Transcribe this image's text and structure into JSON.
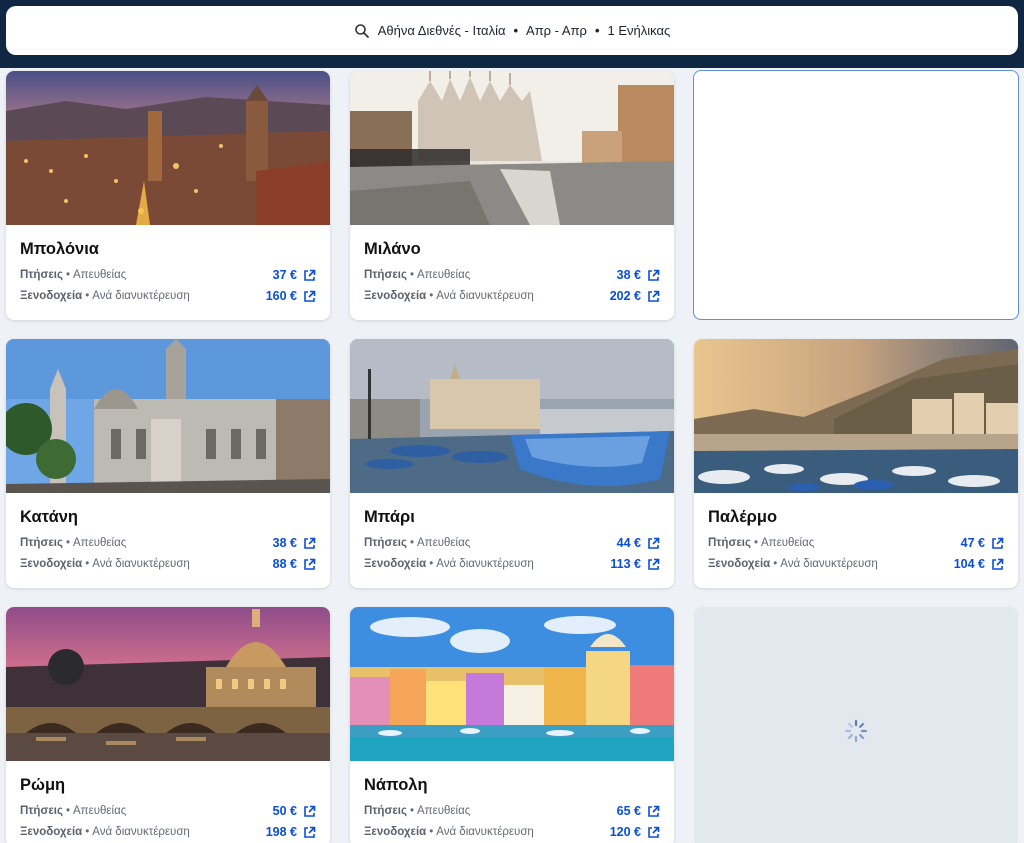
{
  "search": {
    "origin_destination": "Αθήνα Διεθνές - Ιταλία",
    "dates": "Απρ - Απρ",
    "travellers": "1 Ενήλικας",
    "separator": "•"
  },
  "labels": {
    "flights": "Πτήσεις",
    "hotels": "Ξενοδοχεία",
    "flights_detail": "Απευθείας",
    "hotels_detail": "Ανά διανυκτέρευση",
    "bullet": "•"
  },
  "destinations": [
    {
      "city": "Μπολόνια",
      "flight_price": "37 €",
      "hotel_price": "160 €"
    },
    {
      "city": "Μιλάνο",
      "flight_price": "38 €",
      "hotel_price": "202 €"
    },
    {
      "city": "Κατάνη",
      "flight_price": "38 €",
      "hotel_price": "88 €"
    },
    {
      "city": "Μπάρι",
      "flight_price": "44 €",
      "hotel_price": "113 €"
    },
    {
      "city": "Παλέρμο",
      "flight_price": "47 €",
      "hotel_price": "104 €"
    },
    {
      "city": "Ρώμη",
      "flight_price": "50 €",
      "hotel_price": "198 €"
    },
    {
      "city": "Νάπολη",
      "flight_price": "65 €",
      "hotel_price": "120 €"
    }
  ],
  "icons": {
    "search": "search-icon",
    "external_link": "external-link-icon",
    "loading": "loading-spinner-icon"
  },
  "colors": {
    "topbar": "#0f2742",
    "price_link": "#0a4ed8",
    "outline": "#5f8fe0"
  }
}
